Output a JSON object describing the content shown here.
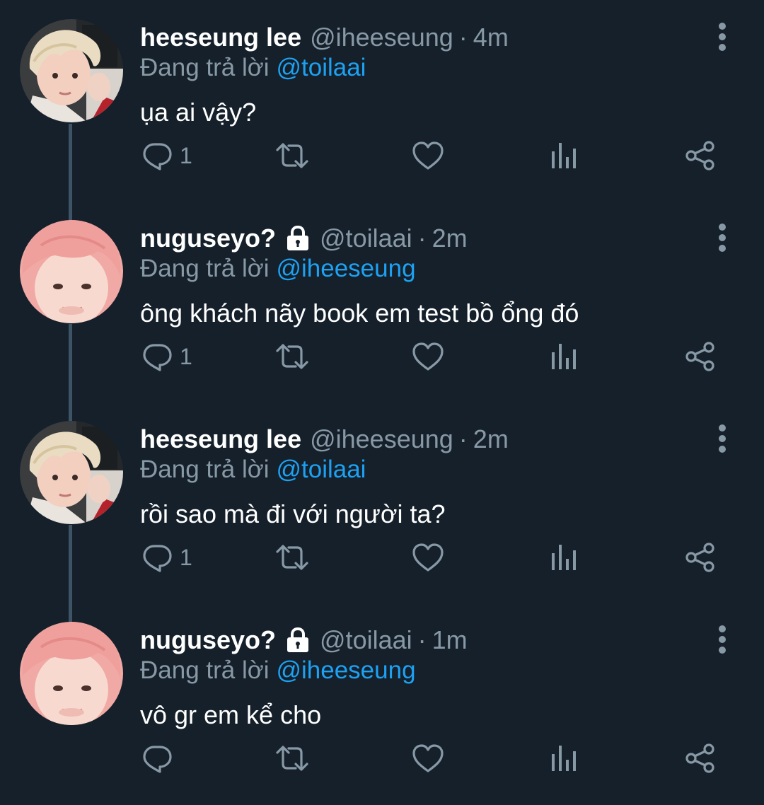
{
  "tweets": [
    {
      "avatar": "blonde-person",
      "name": "heeseung lee",
      "locked": false,
      "handle": "@iheeseung",
      "separator": "·",
      "time": "4m",
      "replying_prefix": "Đang trả lời",
      "replying_to": "@toilaai",
      "text": "ụa ai vậy?",
      "reply_count": "1"
    },
    {
      "avatar": "pink-hair-person",
      "name": "nuguseyo?",
      "locked": true,
      "handle": "@toilaai",
      "separator": "·",
      "time": "2m",
      "replying_prefix": "Đang trả lời",
      "replying_to": "@iheeseung",
      "text": "ông khách nãy book em test bồ ổng đó",
      "reply_count": "1"
    },
    {
      "avatar": "blonde-person",
      "name": "heeseung lee",
      "locked": false,
      "handle": "@iheeseung",
      "separator": "·",
      "time": "2m",
      "replying_prefix": "Đang trả lời",
      "replying_to": "@toilaai",
      "text": "rồi sao mà đi với người ta?",
      "reply_count": "1"
    },
    {
      "avatar": "pink-hair-person",
      "name": "nuguseyo?",
      "locked": true,
      "handle": "@toilaai",
      "separator": "·",
      "time": "1m",
      "replying_prefix": "Đang trả lời",
      "replying_to": "@iheeseung",
      "text": "vô gr em kể cho",
      "reply_count": ""
    }
  ],
  "icons": {
    "reply": "reply-icon",
    "retweet": "retweet-icon",
    "like": "heart-icon",
    "analytics": "analytics-icon",
    "share": "share-icon",
    "more": "more-options-icon",
    "lock": "lock-icon"
  },
  "colors": {
    "background": "#15202b",
    "muted": "#8899a6",
    "link": "#1da1f2",
    "thread_line": "#3d5466"
  }
}
